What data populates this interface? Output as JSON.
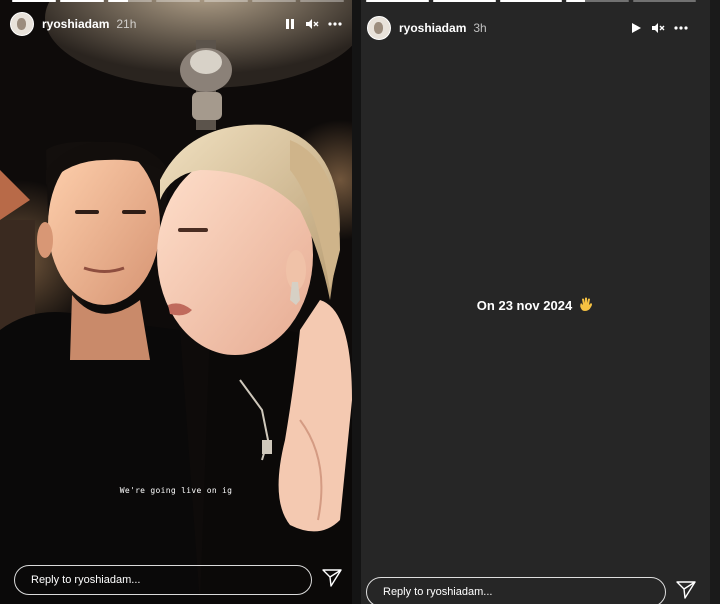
{
  "left_story": {
    "progress": [
      1,
      1,
      0.45,
      0,
      0,
      0,
      0
    ],
    "username": "ryoshiadam",
    "time": "21h",
    "caption": "We're going live on ig",
    "reply_placeholder": "Reply to ryoshiadam...",
    "state_icon": "pause-icon"
  },
  "right_story": {
    "progress": [
      1,
      1,
      1,
      0.3,
      0
    ],
    "username": "ryoshiadam",
    "time": "3h",
    "text": "On 23 nov 2024",
    "emoji": "waving-hand-icon",
    "reply_placeholder": "Reply to ryoshiadam...",
    "state_icon": "play-icon"
  },
  "colors": {
    "text": "#ffffff",
    "panel_bg": "#262626"
  }
}
